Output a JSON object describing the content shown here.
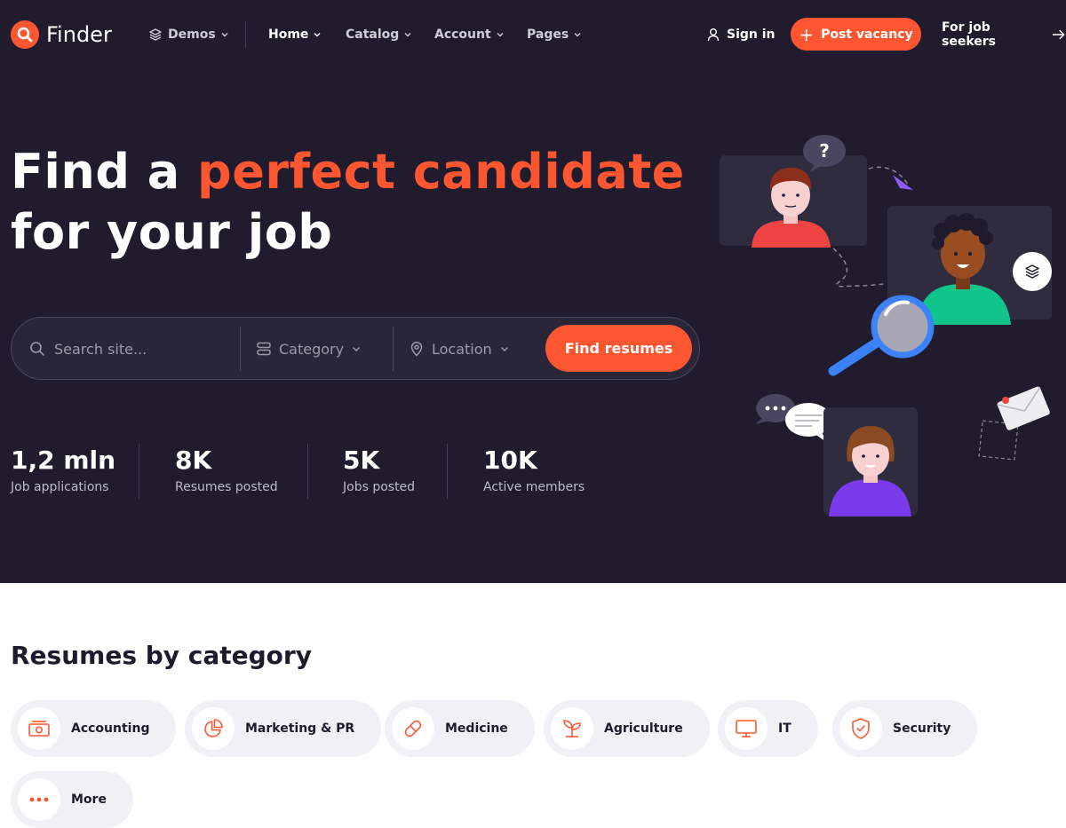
{
  "brand": {
    "name": "Finder",
    "accent": "#fd5631",
    "dark_bg": "#201c2e"
  },
  "nav": {
    "demos": "Demos",
    "home": "Home",
    "catalog": "Catalog",
    "account": "Account",
    "pages": "Pages",
    "sign_in": "Sign in",
    "post_vacancy": "Post vacancy",
    "job_seekers": "For job seekers"
  },
  "hero": {
    "title_part1": "Find a",
    "title_accent": "perfect candidate",
    "title_part2": "for your job"
  },
  "search": {
    "placeholder": "Search site...",
    "category": "Category",
    "location": "Location",
    "button": "Find resumes"
  },
  "stats": [
    {
      "value": "1,2 mln",
      "label": "Job applications"
    },
    {
      "value": "8K",
      "label": "Resumes posted"
    },
    {
      "value": "5K",
      "label": "Jobs posted"
    },
    {
      "value": "10K",
      "label": "Active members"
    }
  ],
  "categories": {
    "title": "Resumes by category",
    "items": [
      {
        "label": "Accounting",
        "icon": "cash-icon"
      },
      {
        "label": "Marketing & PR",
        "icon": "pie-chart-icon"
      },
      {
        "label": "Medicine",
        "icon": "pill-icon"
      },
      {
        "label": "Agriculture",
        "icon": "sprout-icon"
      },
      {
        "label": "IT",
        "icon": "monitor-icon"
      },
      {
        "label": "Security",
        "icon": "shield-icon"
      },
      {
        "label": "More",
        "icon": "dots-icon"
      }
    ]
  }
}
